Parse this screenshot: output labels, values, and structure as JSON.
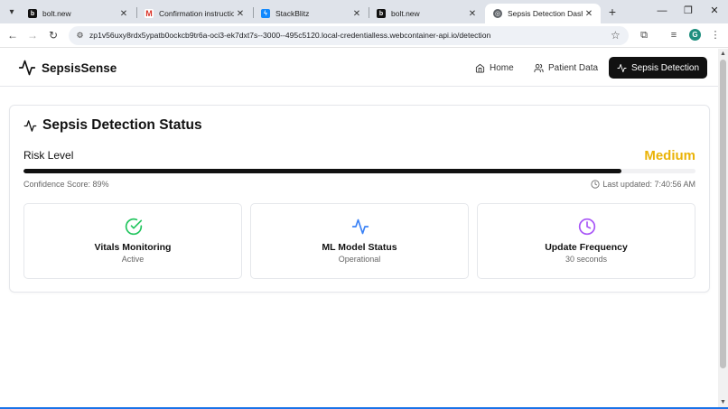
{
  "browser": {
    "tabs": [
      {
        "title": "bolt.new",
        "icon": "bolt-icon",
        "active": false
      },
      {
        "title": "Confirmation instructions",
        "icon": "gmail-icon",
        "active": false
      },
      {
        "title": "StackBlitz",
        "icon": "stackblitz-icon",
        "active": false
      },
      {
        "title": "bolt.new",
        "icon": "bolt-icon",
        "active": false
      },
      {
        "title": "Sepsis Detection Dashboard",
        "icon": "globe-icon",
        "active": true
      }
    ],
    "new_tab_label": "+",
    "url": "zp1v56uxy8rdx5ypatb0ockcb9tr6a-oci3-ek7dxt7s--3000--495c5120.local-credentialless.webcontainer-api.io/detection",
    "profile_initial": "G"
  },
  "app": {
    "brand": "SepsisSense",
    "nav": {
      "home": "Home",
      "patient_data": "Patient Data",
      "sepsis_detection": "Sepsis Detection"
    }
  },
  "status": {
    "title": "Sepsis Detection Status",
    "risk_label": "Risk Level",
    "risk_value": "Medium",
    "risk_progress_percent": 89,
    "confidence_text": "Confidence Score: 89%",
    "last_updated_text": "Last updated: 7:40:56 AM",
    "cards": [
      {
        "title": "Vitals Monitoring",
        "subtitle": "Active",
        "icon": "check-circle-icon",
        "color": "#22c55e"
      },
      {
        "title": "ML Model Status",
        "subtitle": "Operational",
        "icon": "activity-icon",
        "color": "#3b82f6"
      },
      {
        "title": "Update Frequency",
        "subtitle": "30 seconds",
        "icon": "clock-icon",
        "color": "#a855f7"
      }
    ]
  },
  "colors": {
    "risk_medium": "#eab308",
    "primary": "#111111"
  }
}
